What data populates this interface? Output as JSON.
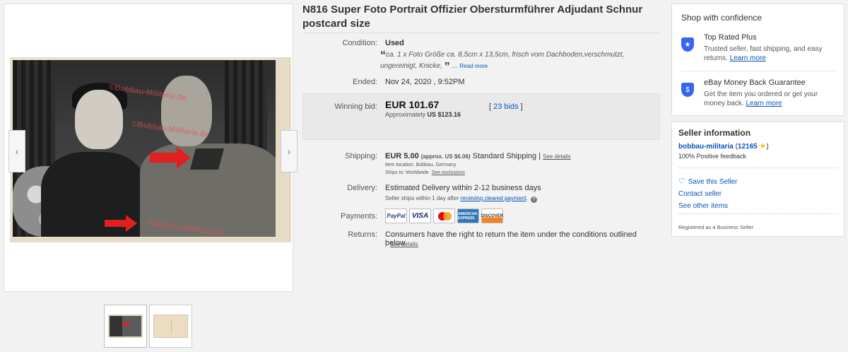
{
  "gallery": {
    "watermarks": [
      "©Bobbau-Militaria.de",
      "©Bobbau-Militaria.de",
      "©Bobbau-Militaria.de"
    ],
    "prev_icon": "‹",
    "next_icon": "›"
  },
  "listing": {
    "title": "N816 Super Foto Portrait Offizier Obersturmführer Adjudant Schnur postcard size",
    "condition_label": "Condition:",
    "condition_value": "Used",
    "description": "ca. 1 x Foto Größe ca. 8,5cm x 13,5cm, frisch vom Dachboden,verschmutzt, ungereinigt, Knicke,",
    "open_quote": "“",
    "close_quote": "”",
    "ellipsis": " ... ",
    "read_more": "Read more",
    "ended_label": "Ended:",
    "ended_value": "Nov 24, 2020 , 9:52PM",
    "winning_bid_label": "Winning bid:",
    "winning_bid_price": "EUR 101.67",
    "approx_prefix": "Approximately ",
    "approx_value": "US $123.16",
    "bids_open": "[ ",
    "bids_link": "23 bids",
    "bids_close": " ]",
    "shipping_label": "Shipping:",
    "shipping_price": "EUR 5.00",
    "shipping_approx": "(approx. US $6.06)",
    "shipping_method": " Standard Shipping | ",
    "shipping_details": "See details",
    "item_location": "Item location:  Bobbau, Germany",
    "ships_to": "Ships to:  Worldwide",
    "see_exclusions": "See exclusions",
    "delivery_label": "Delivery:",
    "delivery_value": "Estimated Delivery within 2-12 business days",
    "delivery_sub_prefix": "Seller ships within 1 day after ",
    "delivery_sub_link": "receiving cleared payment",
    "delivery_sub_suffix": ".",
    "info_icon": "?",
    "payments_label": "Payments:",
    "payments": {
      "paypal": "PayPal",
      "visa": "VISA",
      "amex": "AMERICAN EXPRESS",
      "discover": "DISCOVER"
    },
    "returns_label": "Returns:",
    "returns_value": "Consumers have the right to return the item under the conditions outlined below",
    "returns_bar": "|",
    "returns_details": "See details"
  },
  "confidence": {
    "title": "Shop with confidence",
    "items": [
      {
        "heading": "Top Rated Plus",
        "text": "Trusted seller, fast shipping, and easy returns. ",
        "link": "Learn more",
        "icon": "★"
      },
      {
        "heading": "eBay Money Back Guarantee",
        "text": "Get the item you ordered or get your money back. ",
        "link": "Learn more",
        "icon": "$"
      }
    ]
  },
  "seller": {
    "title": "Seller information",
    "name": "bobbau-militaria",
    "feedback_open": " (",
    "feedback_score": "12165",
    "star": "★",
    "feedback_close": ")",
    "positive": "100% Positive feedback",
    "heart_icon": "♡",
    "save": "Save this Seller",
    "contact": "Contact seller",
    "other": "See other items",
    "registered": "Registered as a Business Seller"
  }
}
